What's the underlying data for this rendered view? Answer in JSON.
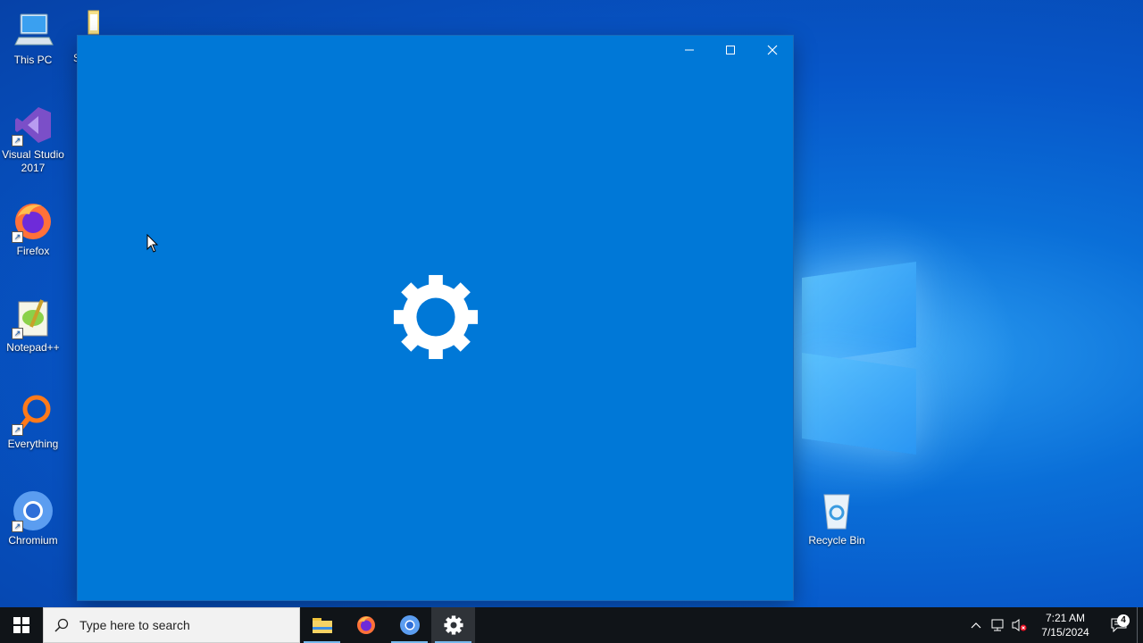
{
  "desktop": {
    "icons": [
      {
        "label": "This PC",
        "icon": "this-pc-icon"
      },
      {
        "label": "Visual Studio 2017",
        "icon": "visual-studio-icon"
      },
      {
        "label": "Firefox",
        "icon": "firefox-icon"
      },
      {
        "label": "Notepad++",
        "icon": "notepadpp-icon"
      },
      {
        "label": "Everything",
        "icon": "everything-icon"
      },
      {
        "label": "Chromium",
        "icon": "chromium-icon"
      },
      {
        "label": "Recycle Bin",
        "icon": "recycle-bin-icon"
      }
    ],
    "partial_label": "S"
  },
  "window": {
    "app": "Settings",
    "splash_icon": "gear-icon",
    "background": "#0078d7"
  },
  "taskbar": {
    "search_placeholder": "Type here to search",
    "apps": [
      "file-explorer-icon",
      "firefox-icon",
      "chromium-icon",
      "settings-gear-icon"
    ],
    "active_app": "settings-gear-icon",
    "time": "7:21 AM",
    "date": "7/15/2024",
    "notification_count": "4"
  }
}
